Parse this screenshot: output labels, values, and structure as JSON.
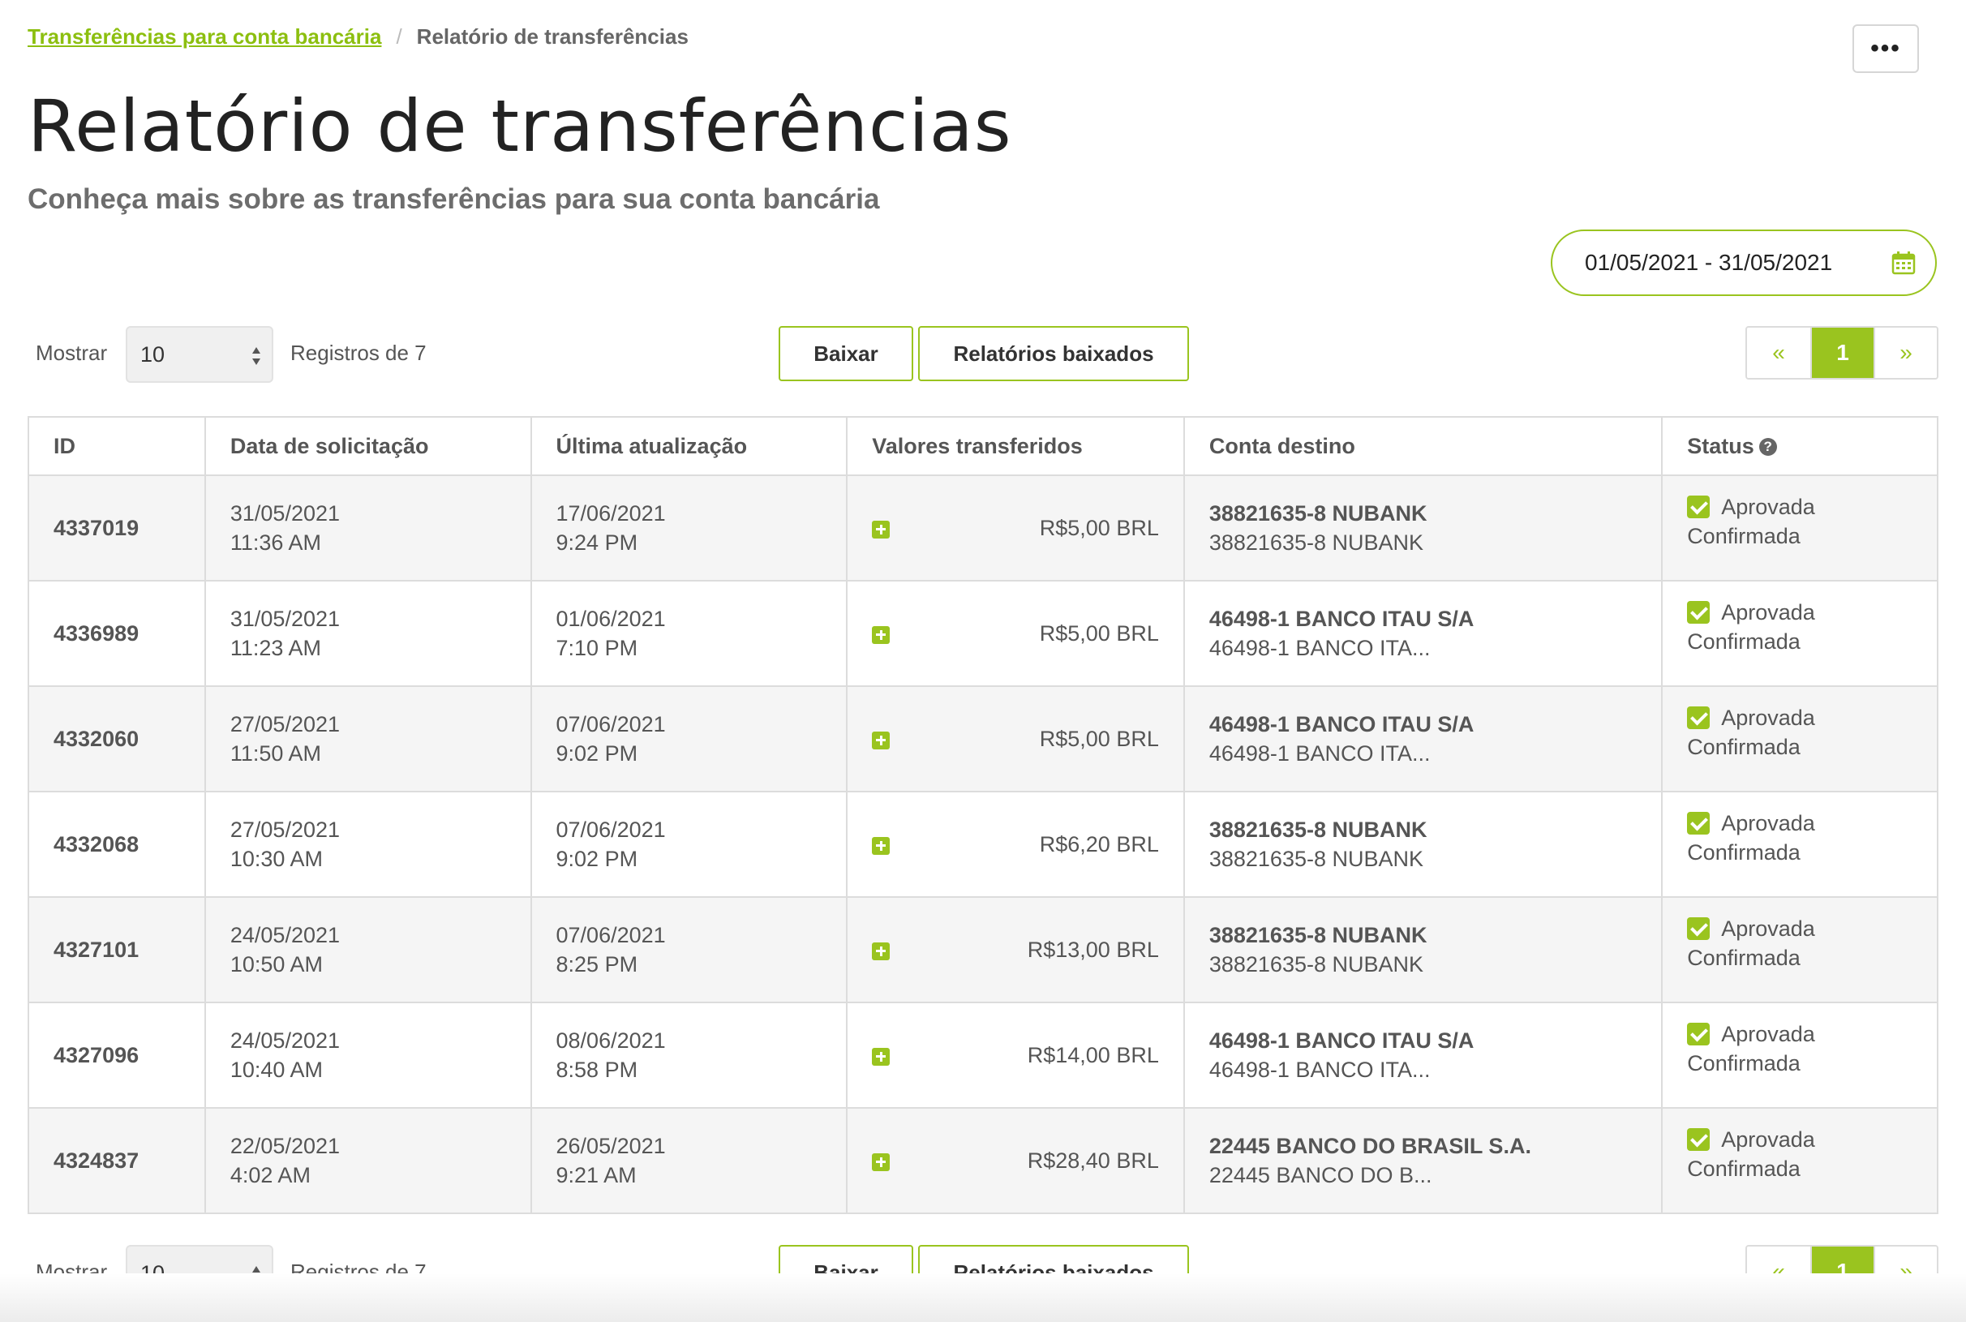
{
  "breadcrumb": {
    "parent": "Transferências para conta bancária",
    "separator": "/",
    "current": "Relatório de transferências"
  },
  "header": {
    "more_label": "•••",
    "title": "Relatório de transferências",
    "subtitle": "Conheça mais sobre as transferências para sua conta bancária"
  },
  "date_filter": {
    "value": "01/05/2021 - 31/05/2021",
    "icon": "calendar-icon"
  },
  "controls": {
    "show_label": "Mostrar",
    "page_size": "10",
    "records_label": "Registros de 7",
    "download_label": "Baixar",
    "downloaded_label": "Relatórios baixados",
    "prev_label": "«",
    "current_page": "1",
    "next_label": "»"
  },
  "table": {
    "columns": [
      "ID",
      "Data de solicitação",
      "Última atualização",
      "Valores transferidos",
      "Conta destino",
      "Status"
    ],
    "rows": [
      {
        "id": "4337019",
        "req_date": "31/05/2021",
        "req_time": "11:36 AM",
        "upd_date": "17/06/2021",
        "upd_time": "9:24 PM",
        "amount": "R$5,00 BRL",
        "acct_main": "38821635-8 NUBANK",
        "acct_sub": "38821635-8 NUBANK",
        "status": "Aprovada",
        "substatus": "Confirmada"
      },
      {
        "id": "4336989",
        "req_date": "31/05/2021",
        "req_time": "11:23 AM",
        "upd_date": "01/06/2021",
        "upd_time": "7:10 PM",
        "amount": "R$5,00 BRL",
        "acct_main": "46498-1 BANCO ITAU S/A",
        "acct_sub": "46498-1 BANCO ITA...",
        "status": "Aprovada",
        "substatus": "Confirmada"
      },
      {
        "id": "4332060",
        "req_date": "27/05/2021",
        "req_time": "11:50 AM",
        "upd_date": "07/06/2021",
        "upd_time": "9:02 PM",
        "amount": "R$5,00 BRL",
        "acct_main": "46498-1 BANCO ITAU S/A",
        "acct_sub": "46498-1 BANCO ITA...",
        "status": "Aprovada",
        "substatus": "Confirmada"
      },
      {
        "id": "4332068",
        "req_date": "27/05/2021",
        "req_time": "10:30 AM",
        "upd_date": "07/06/2021",
        "upd_time": "9:02 PM",
        "amount": "R$6,20 BRL",
        "acct_main": "38821635-8 NUBANK",
        "acct_sub": "38821635-8 NUBANK",
        "status": "Aprovada",
        "substatus": "Confirmada"
      },
      {
        "id": "4327101",
        "req_date": "24/05/2021",
        "req_time": "10:50 AM",
        "upd_date": "07/06/2021",
        "upd_time": "8:25 PM",
        "amount": "R$13,00 BRL",
        "acct_main": "38821635-8 NUBANK",
        "acct_sub": "38821635-8 NUBANK",
        "status": "Aprovada",
        "substatus": "Confirmada"
      },
      {
        "id": "4327096",
        "req_date": "24/05/2021",
        "req_time": "10:40 AM",
        "upd_date": "08/06/2021",
        "upd_time": "8:58 PM",
        "amount": "R$14,00 BRL",
        "acct_main": "46498-1 BANCO ITAU S/A",
        "acct_sub": "46498-1 BANCO ITA...",
        "status": "Aprovada",
        "substatus": "Confirmada"
      },
      {
        "id": "4324837",
        "req_date": "22/05/2021",
        "req_time": "4:02 AM",
        "upd_date": "26/05/2021",
        "upd_time": "9:21 AM",
        "amount": "R$28,40 BRL",
        "acct_main": "22445 BANCO DO BRASIL S.A.",
        "acct_sub": "22445 BANCO DO B...",
        "status": "Aprovada",
        "substatus": "Confirmada"
      }
    ]
  },
  "colors": {
    "accent": "#9ac41f",
    "link": "#8cbf0f",
    "border": "#dcdcdc",
    "row_alt": "#f5f5f5"
  }
}
